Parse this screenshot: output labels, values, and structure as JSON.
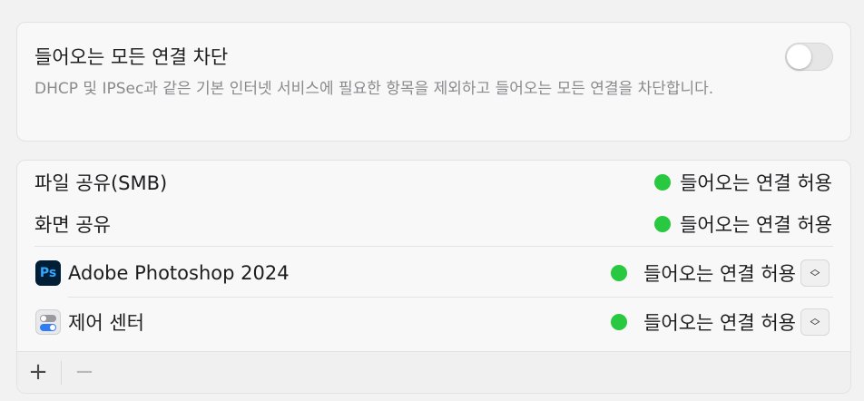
{
  "block_incoming": {
    "title": "들어오는 모든 연결 차단",
    "description": "DHCP 및 IPSec과 같은 기본 인터넷 서비스에 필요한 항목을 제외하고 들어오는 모든 연결을 차단합니다.",
    "toggle_on": false
  },
  "firewall_list": {
    "rows": [
      {
        "name": "파일 공유(SMB)",
        "status": "들어오는 연결 허용",
        "status_color": "#28c840"
      },
      {
        "name": "화면 공유",
        "status": "들어오는 연결 허용",
        "status_color": "#28c840"
      },
      {
        "name": "Adobe Photoshop 2024",
        "icon": "photoshop-app-icon",
        "icon_text": "Ps",
        "status": "들어오는 연결 허용",
        "status_color": "#28c840"
      },
      {
        "name": "제어 센터",
        "icon": "control-center-app-icon",
        "status": "들어오는 연결 허용",
        "status_color": "#28c840"
      }
    ],
    "footer": {
      "add_label": "+",
      "remove_label": "−"
    }
  }
}
